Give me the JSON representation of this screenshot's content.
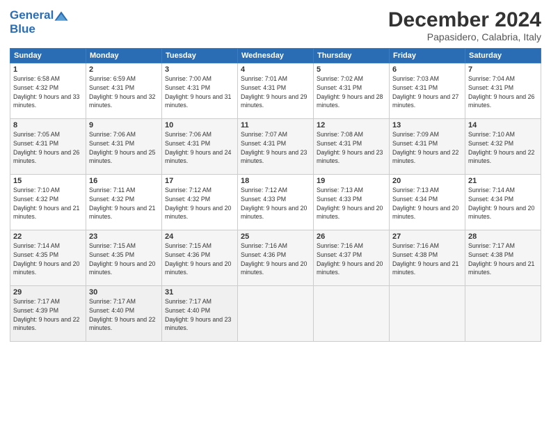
{
  "logo": {
    "line1": "General",
    "line2": "Blue"
  },
  "header": {
    "month": "December 2024",
    "location": "Papasidero, Calabria, Italy"
  },
  "weekdays": [
    "Sunday",
    "Monday",
    "Tuesday",
    "Wednesday",
    "Thursday",
    "Friday",
    "Saturday"
  ],
  "weeks": [
    [
      {
        "day": "1",
        "sunrise": "Sunrise: 6:58 AM",
        "sunset": "Sunset: 4:32 PM",
        "daylight": "Daylight: 9 hours and 33 minutes."
      },
      {
        "day": "2",
        "sunrise": "Sunrise: 6:59 AM",
        "sunset": "Sunset: 4:31 PM",
        "daylight": "Daylight: 9 hours and 32 minutes."
      },
      {
        "day": "3",
        "sunrise": "Sunrise: 7:00 AM",
        "sunset": "Sunset: 4:31 PM",
        "daylight": "Daylight: 9 hours and 31 minutes."
      },
      {
        "day": "4",
        "sunrise": "Sunrise: 7:01 AM",
        "sunset": "Sunset: 4:31 PM",
        "daylight": "Daylight: 9 hours and 29 minutes."
      },
      {
        "day": "5",
        "sunrise": "Sunrise: 7:02 AM",
        "sunset": "Sunset: 4:31 PM",
        "daylight": "Daylight: 9 hours and 28 minutes."
      },
      {
        "day": "6",
        "sunrise": "Sunrise: 7:03 AM",
        "sunset": "Sunset: 4:31 PM",
        "daylight": "Daylight: 9 hours and 27 minutes."
      },
      {
        "day": "7",
        "sunrise": "Sunrise: 7:04 AM",
        "sunset": "Sunset: 4:31 PM",
        "daylight": "Daylight: 9 hours and 26 minutes."
      }
    ],
    [
      {
        "day": "8",
        "sunrise": "Sunrise: 7:05 AM",
        "sunset": "Sunset: 4:31 PM",
        "daylight": "Daylight: 9 hours and 26 minutes."
      },
      {
        "day": "9",
        "sunrise": "Sunrise: 7:06 AM",
        "sunset": "Sunset: 4:31 PM",
        "daylight": "Daylight: 9 hours and 25 minutes."
      },
      {
        "day": "10",
        "sunrise": "Sunrise: 7:06 AM",
        "sunset": "Sunset: 4:31 PM",
        "daylight": "Daylight: 9 hours and 24 minutes."
      },
      {
        "day": "11",
        "sunrise": "Sunrise: 7:07 AM",
        "sunset": "Sunset: 4:31 PM",
        "daylight": "Daylight: 9 hours and 23 minutes."
      },
      {
        "day": "12",
        "sunrise": "Sunrise: 7:08 AM",
        "sunset": "Sunset: 4:31 PM",
        "daylight": "Daylight: 9 hours and 23 minutes."
      },
      {
        "day": "13",
        "sunrise": "Sunrise: 7:09 AM",
        "sunset": "Sunset: 4:31 PM",
        "daylight": "Daylight: 9 hours and 22 minutes."
      },
      {
        "day": "14",
        "sunrise": "Sunrise: 7:10 AM",
        "sunset": "Sunset: 4:32 PM",
        "daylight": "Daylight: 9 hours and 22 minutes."
      }
    ],
    [
      {
        "day": "15",
        "sunrise": "Sunrise: 7:10 AM",
        "sunset": "Sunset: 4:32 PM",
        "daylight": "Daylight: 9 hours and 21 minutes."
      },
      {
        "day": "16",
        "sunrise": "Sunrise: 7:11 AM",
        "sunset": "Sunset: 4:32 PM",
        "daylight": "Daylight: 9 hours and 21 minutes."
      },
      {
        "day": "17",
        "sunrise": "Sunrise: 7:12 AM",
        "sunset": "Sunset: 4:32 PM",
        "daylight": "Daylight: 9 hours and 20 minutes."
      },
      {
        "day": "18",
        "sunrise": "Sunrise: 7:12 AM",
        "sunset": "Sunset: 4:33 PM",
        "daylight": "Daylight: 9 hours and 20 minutes."
      },
      {
        "day": "19",
        "sunrise": "Sunrise: 7:13 AM",
        "sunset": "Sunset: 4:33 PM",
        "daylight": "Daylight: 9 hours and 20 minutes."
      },
      {
        "day": "20",
        "sunrise": "Sunrise: 7:13 AM",
        "sunset": "Sunset: 4:34 PM",
        "daylight": "Daylight: 9 hours and 20 minutes."
      },
      {
        "day": "21",
        "sunrise": "Sunrise: 7:14 AM",
        "sunset": "Sunset: 4:34 PM",
        "daylight": "Daylight: 9 hours and 20 minutes."
      }
    ],
    [
      {
        "day": "22",
        "sunrise": "Sunrise: 7:14 AM",
        "sunset": "Sunset: 4:35 PM",
        "daylight": "Daylight: 9 hours and 20 minutes."
      },
      {
        "day": "23",
        "sunrise": "Sunrise: 7:15 AM",
        "sunset": "Sunset: 4:35 PM",
        "daylight": "Daylight: 9 hours and 20 minutes."
      },
      {
        "day": "24",
        "sunrise": "Sunrise: 7:15 AM",
        "sunset": "Sunset: 4:36 PM",
        "daylight": "Daylight: 9 hours and 20 minutes."
      },
      {
        "day": "25",
        "sunrise": "Sunrise: 7:16 AM",
        "sunset": "Sunset: 4:36 PM",
        "daylight": "Daylight: 9 hours and 20 minutes."
      },
      {
        "day": "26",
        "sunrise": "Sunrise: 7:16 AM",
        "sunset": "Sunset: 4:37 PM",
        "daylight": "Daylight: 9 hours and 20 minutes."
      },
      {
        "day": "27",
        "sunrise": "Sunrise: 7:16 AM",
        "sunset": "Sunset: 4:38 PM",
        "daylight": "Daylight: 9 hours and 21 minutes."
      },
      {
        "day": "28",
        "sunrise": "Sunrise: 7:17 AM",
        "sunset": "Sunset: 4:38 PM",
        "daylight": "Daylight: 9 hours and 21 minutes."
      }
    ],
    [
      {
        "day": "29",
        "sunrise": "Sunrise: 7:17 AM",
        "sunset": "Sunset: 4:39 PM",
        "daylight": "Daylight: 9 hours and 22 minutes."
      },
      {
        "day": "30",
        "sunrise": "Sunrise: 7:17 AM",
        "sunset": "Sunset: 4:40 PM",
        "daylight": "Daylight: 9 hours and 22 minutes."
      },
      {
        "day": "31",
        "sunrise": "Sunrise: 7:17 AM",
        "sunset": "Sunset: 4:40 PM",
        "daylight": "Daylight: 9 hours and 23 minutes."
      },
      null,
      null,
      null,
      null
    ]
  ]
}
